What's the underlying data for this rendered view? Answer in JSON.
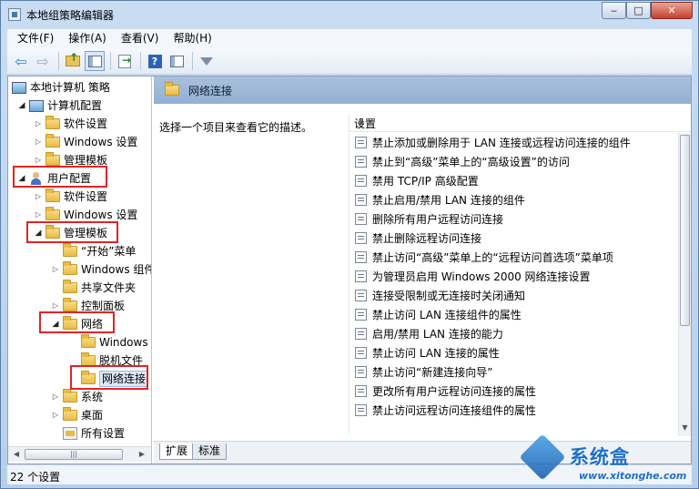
{
  "window": {
    "title": "本地组策略编辑器",
    "minimize": "‒",
    "maximize": "□",
    "close": "✕"
  },
  "menu": [
    "文件(F)",
    "操作(A)",
    "查看(V)",
    "帮助(H)"
  ],
  "tree": {
    "root": "本地计算机 策略",
    "computer_config": "计算机配置",
    "cc_software": "软件设置",
    "cc_windows": "Windows 设置",
    "cc_admin": "管理模板",
    "user_config": "用户配置",
    "uc_software": "软件设置",
    "uc_windows": "Windows 设置",
    "uc_admin": "管理模板",
    "start_menu": "“开始”菜单",
    "windows_components": "Windows 组件",
    "shared_folders": "共享文件夹",
    "control_panel": "控制面板",
    "network": "网络",
    "net_windows": "Windows",
    "offline_files": "脱机文件",
    "network_connections": "网络连接",
    "system": "系统",
    "desktop": "桌面",
    "all_settings": "所有设置"
  },
  "right_panel": {
    "header": "网络连接",
    "description": "选择一个项目来查看它的描述。",
    "column_header": "设置",
    "items": [
      "禁止添加或删除用于 LAN 连接或远程访问连接的组件",
      "禁止到“高级”菜单上的“高级设置”的访问",
      "禁用 TCP/IP 高级配置",
      "禁止启用/禁用 LAN 连接的组件",
      "删除所有用户远程访问连接",
      "禁止删除远程访问连接",
      "禁止访问“高级”菜单上的“远程访问首选项”菜单项",
      "为管理员启用 Windows 2000 网络连接设置",
      "连接受限制或无连接时关闭通知",
      "禁止访问 LAN 连接组件的属性",
      "启用/禁用 LAN 连接的能力",
      "禁止访问 LAN 连接的属性",
      "禁止访问“新建连接向导”",
      "更改所有用户远程访问连接的属性",
      "禁止访问远程访问连接组件的属性"
    ]
  },
  "tabs": [
    "扩展",
    "标准"
  ],
  "status": "22 个设置",
  "watermark": {
    "brand": "系统盒",
    "url": "www.xitonghe.com"
  },
  "colors": {
    "highlight_box": "#e02424",
    "header_bg": "#93afd1"
  },
  "icons": {
    "toolbar": [
      "back-arrow-icon",
      "forward-arrow-icon",
      "up-folder-icon",
      "show-hide-tree-icon",
      "export-list-icon",
      "help-icon",
      "properties-icon",
      "filter-icon"
    ]
  }
}
